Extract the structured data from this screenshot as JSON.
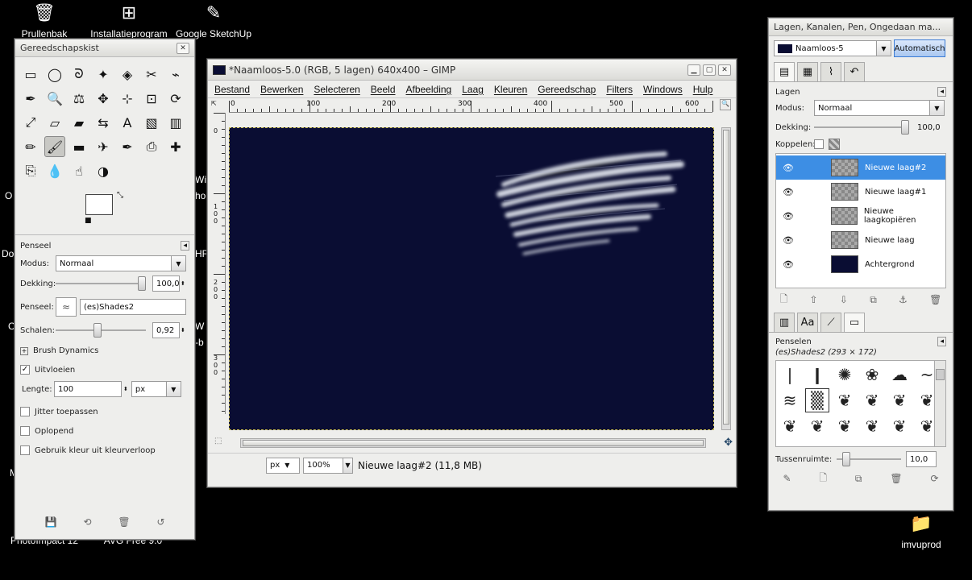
{
  "desktop": {
    "icons": [
      {
        "label": "Prullenbak",
        "icon": "recycle-bin-icon",
        "glyph": "🗑"
      },
      {
        "label": "Installatieprogram",
        "icon": "windows-logo-icon",
        "glyph": "⊞"
      },
      {
        "label": "Google SketchUp",
        "icon": "sketchup-icon",
        "glyph": "✎"
      },
      {
        "label": "PhotoImpact 12",
        "icon": "photoimpact-icon",
        "glyph": ""
      },
      {
        "label": "AVG Free 9.0",
        "icon": "avg-icon",
        "glyph": ""
      },
      {
        "label": "imvuprod",
        "icon": "folder-icon",
        "glyph": "📁"
      }
    ],
    "fragments": [
      "Wir",
      "ho",
      "HF",
      "W",
      "r-b",
      "O",
      "Do",
      "C",
      "M"
    ]
  },
  "toolbox": {
    "title": "Gereedschapskist",
    "tools": [
      "rect-select-icon",
      "ellipse-select-icon",
      "lasso-icon",
      "fuzzy-select-icon",
      "color-select-icon",
      "scissors-icon",
      "paths-icon",
      "color-picker-icon",
      "zoom-icon",
      "measure-icon",
      "move-icon",
      "align-icon",
      "crop-icon",
      "rotate-icon",
      "scale-icon",
      "shear-icon",
      "perspective-icon",
      "flip-icon",
      "text-icon",
      "bucket-fill-icon",
      "blend-icon",
      "pencil-icon",
      "paintbrush-icon",
      "eraser-icon",
      "airbrush-icon",
      "ink-icon",
      "clone-icon",
      "heal-icon",
      "perspective-clone-icon",
      "blur-icon",
      "smudge-icon",
      "dodge-burn-icon"
    ],
    "tool_glyphs": [
      "▭",
      "◯",
      "ᘐ",
      "✦",
      "◈",
      "✂",
      "⌁",
      "✒",
      "🔍",
      "⚖",
      "✥",
      "⊹",
      "⊡",
      "⟳",
      "⤢",
      "▱",
      "▰",
      "⇆",
      "A",
      "▧",
      "▥",
      "✏",
      "🖌",
      "▬",
      "✈",
      "✒",
      "⎙",
      "✚",
      "⎘",
      "💧",
      "☝",
      "◑"
    ],
    "selected_tool_index": 22,
    "fg_color": "#ffffff",
    "bg_color": "#000a2e",
    "panel_title": "Penseel",
    "modus_label": "Modus:",
    "modus_value": "Normaal",
    "dekking_label": "Dekking:",
    "dekking_value": "100,0",
    "dekking_fraction": 1.0,
    "penseel_label": "Penseel:",
    "penseel_value": "(es)Shades2",
    "schalen_label": "Schalen:",
    "schalen_value": "0,92",
    "schalen_fraction": 0.46,
    "brush_dynamics": "Brush Dynamics",
    "uitvloeien_label": "Uitvloeien",
    "uitvloeien_checked": true,
    "lengte_label": "Lengte:",
    "lengte_value": "100",
    "lengte_unit": "px",
    "options": [
      {
        "label": "Jitter toepassen",
        "checked": false
      },
      {
        "label": "Oplopend",
        "checked": false
      },
      {
        "label": "Gebruik kleur uit kleurverloop",
        "checked": false
      }
    ],
    "footer_icons": [
      "save-icon",
      "restore-icon",
      "delete-icon",
      "reset-icon"
    ],
    "footer_glyphs": [
      "💾",
      "⟲",
      "🗑",
      "↺"
    ]
  },
  "image_window": {
    "title": "*Naamloos-5.0 (RGB, 5 lagen) 640x400 – GIMP",
    "menu": [
      "Bestand",
      "Bewerken",
      "Selecteren",
      "Beeld",
      "Afbeelding",
      "Laag",
      "Kleuren",
      "Gereedschap",
      "Filters",
      "Windows",
      "Hulp"
    ],
    "ruler_h": [
      "0",
      "100",
      "200",
      "300",
      "400",
      "500",
      "600"
    ],
    "ruler_v": [
      "0",
      "1 0 0",
      "2 0 0",
      "3 0 0"
    ],
    "canvas_color": "#0a0d33",
    "status_unit": "px",
    "status_zoom": "100%",
    "status_text": "Nieuwe laag#2 (11,8 MB)"
  },
  "dock": {
    "title": "Lagen, Kanalen, Pen, Ongedaan ma...",
    "image_name": "Naamloos-5",
    "auto_button": "Automatisch",
    "tabs": [
      "layers-tab-icon",
      "channels-tab-icon",
      "paths-tab-icon",
      "undo-tab-icon"
    ],
    "tab_glyphs": [
      "▤",
      "▦",
      "⌇",
      "↶"
    ],
    "layers_title": "Lagen",
    "modus_label": "Modus:",
    "modus_value": "Normaal",
    "dekking_label": "Dekking:",
    "dekking_value": "100,0",
    "koppelen_label": "Koppelen:",
    "layers": [
      {
        "name": "Nieuwe laag#2",
        "selected": true,
        "bg": false
      },
      {
        "name": "Nieuwe laag#1",
        "selected": false,
        "bg": false
      },
      {
        "name": "Nieuwe laagkopiëren",
        "selected": false,
        "bg": false
      },
      {
        "name": "Nieuwe laag",
        "selected": false,
        "bg": false
      },
      {
        "name": "Achtergrond",
        "selected": false,
        "bg": true
      }
    ],
    "layer_buttons": [
      "new-layer-icon",
      "raise-layer-icon",
      "lower-layer-icon",
      "duplicate-layer-icon",
      "anchor-layer-icon",
      "delete-layer-icon"
    ],
    "layer_button_glyphs": [
      "🗋",
      "⇧",
      "⇩",
      "⧉",
      "⚓",
      "🗑"
    ],
    "brush_tabs": [
      "gradients-tab-icon",
      "fonts-tab-icon",
      "brushes-small-tab-icon",
      "brushes-tab-icon"
    ],
    "brush_tab_glyphs": [
      "▥",
      "Aa",
      "⟋",
      "▭"
    ],
    "brushes_title": "Penselen",
    "brush_name": "(es)Shades2 (293 × 172)",
    "tussenruimte_label": "Tussenruimte:",
    "tussenruimte_value": "10,0",
    "tussenruimte_fraction": 0.1,
    "brush_buttons": [
      "edit-brush-icon",
      "new-brush-icon",
      "duplicate-brush-icon",
      "delete-brush-icon",
      "refresh-brush-icon"
    ],
    "brush_button_glyphs": [
      "✎",
      "🗋",
      "⧉",
      "🗑",
      "⟳"
    ]
  }
}
